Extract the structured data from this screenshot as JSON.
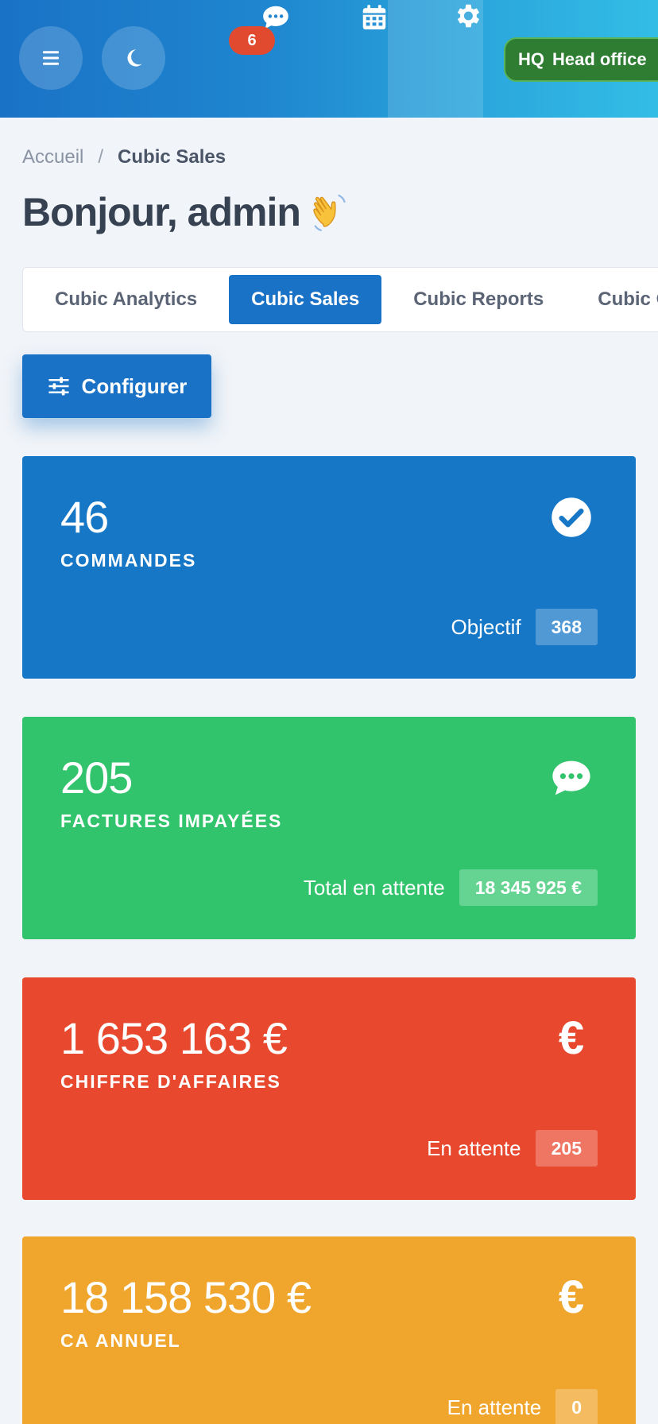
{
  "header": {
    "notification_count": "6",
    "office": {
      "code": "HQ",
      "name": "Head office"
    },
    "icons": [
      "menu-icon",
      "moon-icon",
      "chat-icon",
      "calendar-icon",
      "gear-icon"
    ]
  },
  "breadcrumb": {
    "home": "Accueil",
    "separator": "/",
    "current": "Cubic Sales"
  },
  "greeting": "Bonjour, admin",
  "tabs": [
    {
      "label": "Cubic Analytics"
    },
    {
      "label": "Cubic Sales"
    },
    {
      "label": "Cubic Reports"
    },
    {
      "label": "Cubic Orders"
    }
  ],
  "configure_label": "Configurer",
  "cards": {
    "orders": {
      "value": "46",
      "label": "COMMANDES",
      "footer_label": "Objectif",
      "footer_value": "368",
      "color": "#1677c7",
      "icon": "check-circle-icon"
    },
    "unpaid": {
      "value": "205",
      "label": "FACTURES IMPAYÉES",
      "footer_label": "Total en attente",
      "footer_value": "18 345 925 €",
      "color": "#32c46c",
      "icon": "comment-icon"
    },
    "revenue": {
      "value": "1 653 163 €",
      "label": "CHIFFRE D'AFFAIRES",
      "footer_label": "En attente",
      "footer_value": "205",
      "color": "#e8492e",
      "icon": "euro-icon",
      "icon_glyph": "€"
    },
    "annual": {
      "value": "18 158 530 €",
      "label": "CA ANNUEL",
      "footer_label": "En attente",
      "footer_value": "0",
      "color": "#f0a52d",
      "icon": "euro-icon",
      "icon_glyph": "€"
    }
  }
}
